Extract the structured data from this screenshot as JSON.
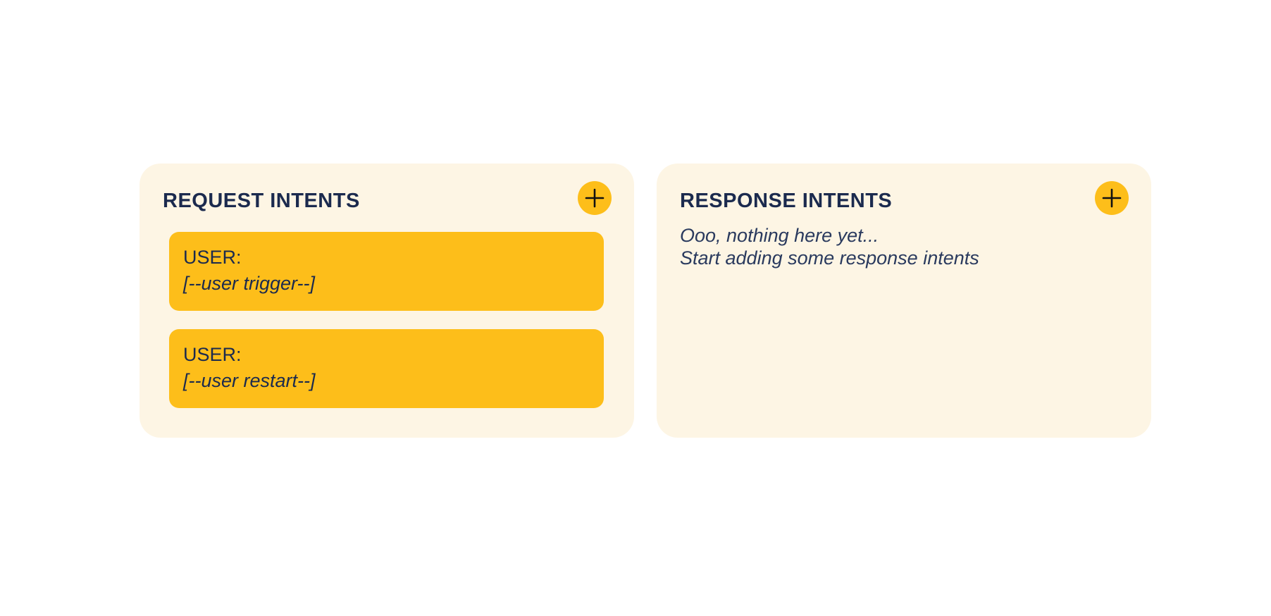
{
  "request_panel": {
    "title": "REQUEST INTENTS",
    "add_icon": "plus-icon",
    "intents": [
      {
        "role": "USER:",
        "trigger": "[--user trigger--]"
      },
      {
        "role": "USER:",
        "trigger": "[--user restart--]"
      }
    ]
  },
  "response_panel": {
    "title": "RESPONSE INTENTS",
    "add_icon": "plus-icon",
    "empty_line_1": "Ooo, nothing here yet...",
    "empty_line_2": "Start adding some response intents"
  },
  "colors": {
    "panel_bg": "#fdf5e4",
    "accent": "#fdbe1a",
    "text": "#1b2a4e"
  }
}
